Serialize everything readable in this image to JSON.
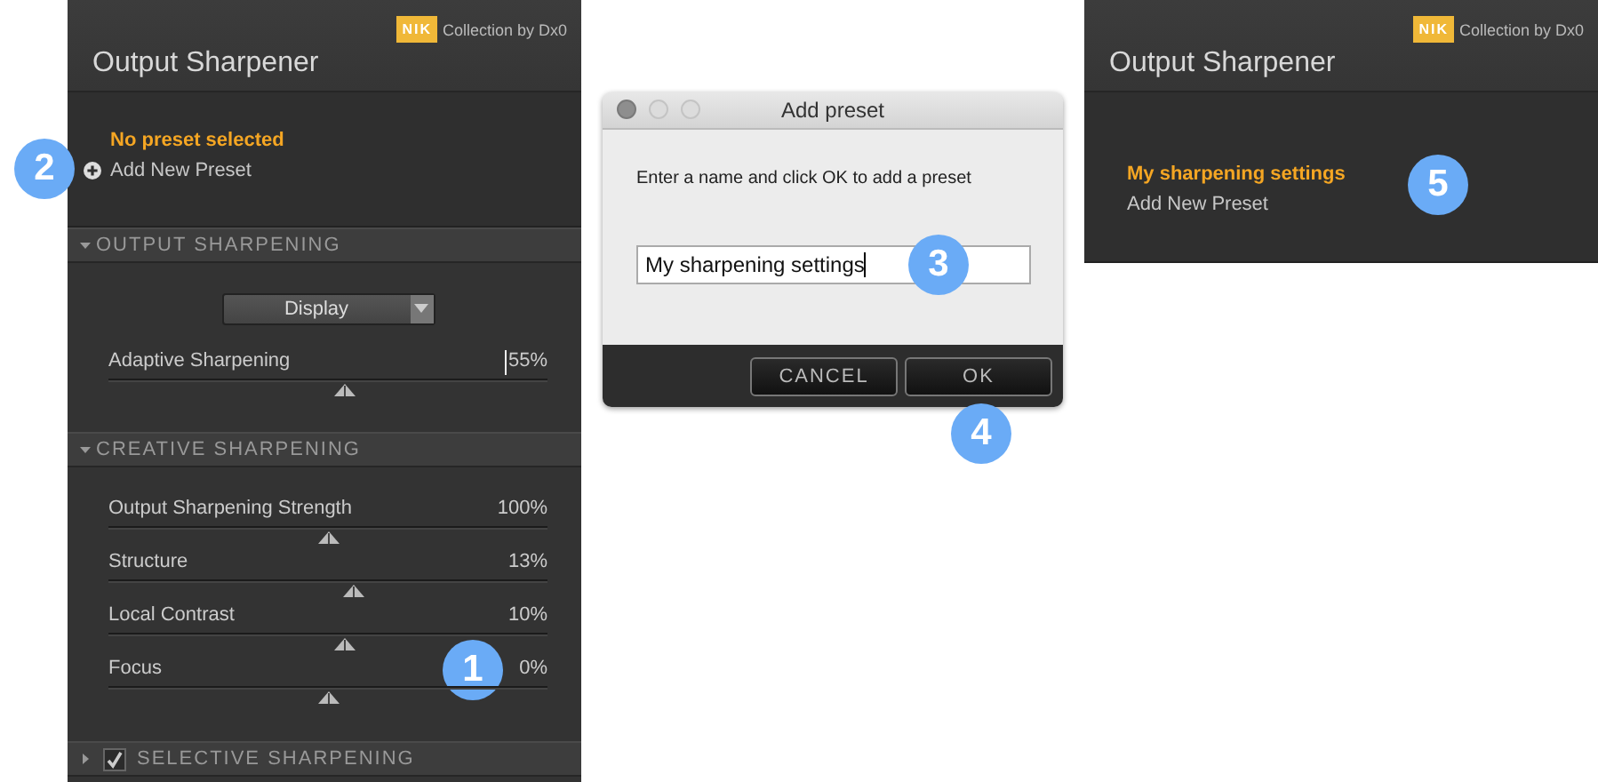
{
  "panels": [
    {
      "logo": "NIK",
      "brand": "Collection by Dx0",
      "title": "Output Sharpener",
      "preset": {
        "current": "No preset selected",
        "add": "Add New Preset",
        "add_icon": true,
        "add_callout": "2"
      },
      "sections": [
        {
          "title": "OUTPUT SHARPENING",
          "expanded": true,
          "dropdown": "Display",
          "sliders": [
            {
              "label": "Adaptive Sharpening",
              "reading": "55%",
              "level": 0.54,
              "editing": true
            }
          ]
        },
        {
          "title": "CREATIVE SHARPENING",
          "expanded": true,
          "sliders": [
            {
              "label": "Output Sharpening Strength",
              "reading": "100%",
              "level": 0.5
            },
            {
              "label": "Structure",
              "reading": "13%",
              "level": 0.56
            },
            {
              "label": "Local Contrast",
              "reading": "10%",
              "level": 0.54
            },
            {
              "label": "Focus",
              "reading": "0%",
              "level": 0.5,
              "callout": "1"
            }
          ]
        },
        {
          "title": "SELECTIVE SHARPENING",
          "expanded": false,
          "checked": true
        }
      ]
    },
    {
      "logo": "NIK",
      "brand": "Collection by Dx0",
      "title": "Output Sharpener",
      "preset": {
        "current": "My sharpening settings",
        "current_callout": "5",
        "add": "Add New Preset",
        "add_icon": false
      }
    }
  ],
  "dialog": {
    "title": "Add preset",
    "message": "Enter a name and click OK to add a preset",
    "value": "My sharpening settings",
    "field_callout": "3",
    "buttons": [
      {
        "label": "CANCEL"
      },
      {
        "label": "OK",
        "callout": "4"
      }
    ]
  }
}
